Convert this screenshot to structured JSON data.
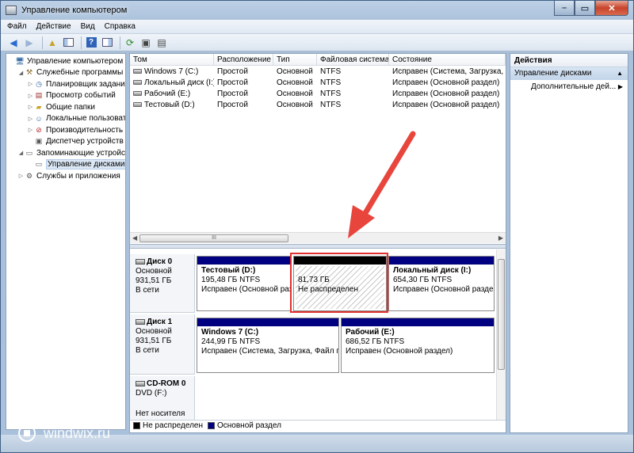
{
  "window": {
    "title": "Управление компьютером"
  },
  "menu": [
    "Файл",
    "Действие",
    "Вид",
    "Справка"
  ],
  "tree": [
    {
      "label": "Управление компьютером (л",
      "level": 0,
      "expander": "",
      "icon": "computer-icon"
    },
    {
      "label": "Служебные программы",
      "level": 1,
      "expander": "◢",
      "icon": "tools-icon"
    },
    {
      "label": "Планировщик заданий",
      "level": 2,
      "expander": "▷",
      "icon": "clock-icon"
    },
    {
      "label": "Просмотр событий",
      "level": 2,
      "expander": "▷",
      "icon": "event-log-icon"
    },
    {
      "label": "Общие папки",
      "level": 2,
      "expander": "▷",
      "icon": "shared-folder-icon"
    },
    {
      "label": "Локальные пользовате",
      "level": 2,
      "expander": "▷",
      "icon": "users-icon"
    },
    {
      "label": "Производительность",
      "level": 2,
      "expander": "▷",
      "icon": "performance-icon"
    },
    {
      "label": "Диспетчер устройств",
      "level": 2,
      "expander": "",
      "icon": "device-manager-icon"
    },
    {
      "label": "Запоминающие устройст",
      "level": 1,
      "expander": "◢",
      "icon": "storage-icon"
    },
    {
      "label": "Управление дисками",
      "level": 2,
      "expander": "",
      "icon": "disk-management-icon",
      "selected": true
    },
    {
      "label": "Службы и приложения",
      "level": 1,
      "expander": "▷",
      "icon": "services-icon"
    }
  ],
  "volume_table": {
    "columns": [
      "Том",
      "Расположение",
      "Тип",
      "Файловая система",
      "Состояние"
    ],
    "rows": [
      [
        "Windows 7 (C:)",
        "Простой",
        "Основной",
        "NTFS",
        "Исправен (Система, Загрузка, Фа"
      ],
      [
        "Локальный диск (I:)",
        "Простой",
        "Основной",
        "NTFS",
        "Исправен (Основной раздел)"
      ],
      [
        "Рабочий (E:)",
        "Простой",
        "Основной",
        "NTFS",
        "Исправен (Основной раздел)"
      ],
      [
        "Тестовый (D:)",
        "Простой",
        "Основной",
        "NTFS",
        "Исправен (Основной раздел)"
      ]
    ],
    "scroll_grip": "III"
  },
  "disks": {
    "disk0": {
      "name": "Диск 0",
      "type": "Основной",
      "size": "931,51 ГБ",
      "status": "В сети",
      "p1": {
        "name": "Тестовый (D:)",
        "size": "195,48 ГБ NTFS",
        "status": "Исправен (Основной разд"
      },
      "p2": {
        "size": "81,73 ГБ",
        "status": "Не распределен"
      },
      "p3": {
        "name": "Локальный диск (I:)",
        "size": "654,30 ГБ NTFS",
        "status": "Исправен (Основной разде"
      }
    },
    "disk1": {
      "name": "Диск 1",
      "type": "Основной",
      "size": "931,51 ГБ",
      "status": "В сети",
      "p1": {
        "name": "Windows 7 (C:)",
        "size": "244,99 ГБ NTFS",
        "status": "Исправен (Система, Загрузка, Файл по"
      },
      "p2": {
        "name": "Рабочий (E:)",
        "size": "686,52 ГБ NTFS",
        "status": "Исправен (Основной раздел)"
      }
    },
    "cdrom": {
      "name": "CD-ROM 0",
      "type": "DVD (F:)",
      "status": "Нет носителя"
    }
  },
  "legend": {
    "unallocated": "Не распределен",
    "primary": "Основной раздел"
  },
  "actions": {
    "header": "Действия",
    "section": "Управление дисками",
    "more": "Дополнительные дей..."
  },
  "watermark": "windwix.ru",
  "colors": {
    "primary_partition": "#000080",
    "unallocated": "#000000",
    "highlight": "#e03030",
    "arrow": "#e8453c"
  }
}
